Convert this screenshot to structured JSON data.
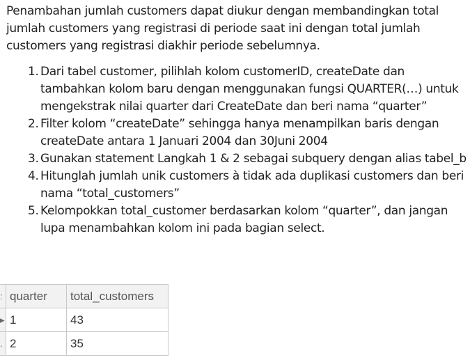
{
  "intro": "Penambahan jumlah customers dapat diukur dengan membandingkan total jumlah customers yang registrasi di periode saat ini dengan total jumlah customers yang registrasi diakhir periode sebelumnya.",
  "steps": [
    {
      "num": "1.",
      "text": "Dari tabel customer, pilihlah kolom customerID, createDate dan tambahkan kolom baru dengan menggunakan fungsi QUARTER(…) untuk mengekstrak nilai quarter dari CreateDate dan beri nama “quarter”"
    },
    {
      "num": "2.",
      "text": "Filter kolom “createDate” sehingga hanya menampilkan baris dengan createDate antara 1 Januari 2004 dan 30Juni 2004"
    },
    {
      "num": "3.",
      "text": "Gunakan statement Langkah 1 & 2 sebagai subquery dengan alias tabel_b"
    },
    {
      "num": "4.",
      "text": "Hitunglah jumlah unik customers à tidak ada duplikasi customers dan beri nama “total_customers”"
    },
    {
      "num": "5.",
      "text": "Kelompokkan total_customer berdasarkan kolom “quarter”, dan jangan lupa menambahkan kolom ini pada bagian select."
    }
  ],
  "result_table": {
    "columns": [
      "quarter",
      "total_customers"
    ],
    "rows": [
      {
        "marker": "▸",
        "quarter": "1",
        "total_customers": "43"
      },
      {
        "marker": ".",
        "quarter": "2",
        "total_customers": "35"
      }
    ],
    "header_marker": ":"
  }
}
